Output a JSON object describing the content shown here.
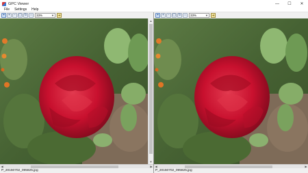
{
  "window": {
    "title": "GPC Viewer",
    "minimize_glyph": "—",
    "maximize_glyph": "☐",
    "close_glyph": "✕"
  },
  "menu": {
    "items": [
      "File",
      "Settings",
      "Help"
    ]
  },
  "toolbar": {
    "buttons": [
      {
        "icon": "pointer-icon",
        "glyph": "⌖"
      },
      {
        "icon": "zoom-in-icon",
        "glyph": "+"
      },
      {
        "icon": "zoom-out-icon",
        "glyph": "−"
      },
      {
        "icon": "fit-window-icon",
        "glyph": "▢"
      },
      {
        "icon": "rotate-icon",
        "glyph": "↻"
      },
      {
        "icon": "flip-icon",
        "glyph": "⇔"
      }
    ],
    "zoom_value": "33%",
    "apply_icon": "arrow-icon",
    "apply_glyph": "➔"
  },
  "panes": [
    {
      "filename": "P_20150702_095825.jpg"
    },
    {
      "filename": "P_20150702_095825.jpg"
    }
  ],
  "colors": {
    "rose": "#c8102e",
    "foliage": "#4f6b38",
    "leaf": "#7fa860",
    "soil": "#8a7560"
  }
}
